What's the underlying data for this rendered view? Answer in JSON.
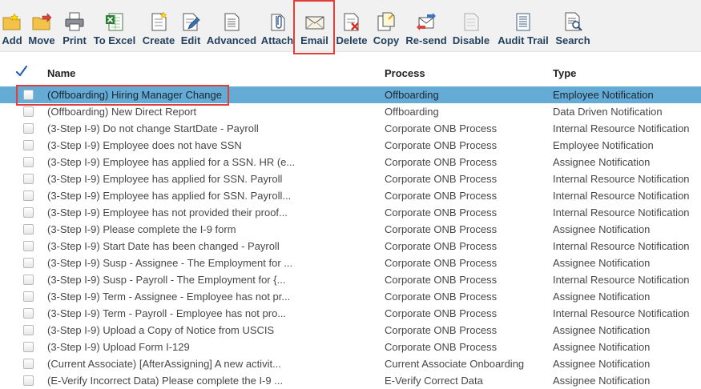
{
  "toolbar": {
    "buttons": [
      {
        "label": "Add",
        "icon": "folder-add-icon"
      },
      {
        "label": "Move",
        "icon": "folder-move-icon"
      },
      {
        "label": "Print",
        "icon": "printer-icon"
      },
      {
        "label": "To Excel",
        "icon": "excel-icon"
      },
      {
        "label": "Create",
        "icon": "create-icon"
      },
      {
        "label": "Edit",
        "icon": "edit-icon"
      },
      {
        "label": "Advanced",
        "icon": "advanced-icon"
      },
      {
        "label": "Attach",
        "icon": "paperclip-icon"
      },
      {
        "label": "Email",
        "icon": "envelope-icon"
      },
      {
        "label": "Delete",
        "icon": "delete-icon"
      },
      {
        "label": "Copy",
        "icon": "copy-icon"
      },
      {
        "label": "Re-send",
        "icon": "resend-icon"
      },
      {
        "label": "Disable",
        "icon": "disable-icon"
      },
      {
        "label": "Audit Trail",
        "icon": "audit-trail-icon"
      },
      {
        "label": "Search",
        "icon": "search-icon"
      }
    ]
  },
  "table": {
    "columns": {
      "name": "Name",
      "process": "Process",
      "type": "Type"
    },
    "rows": [
      {
        "name": "(Offboarding) Hiring Manager Change",
        "process": "Offboarding",
        "type": "Employee Notification",
        "selected": true
      },
      {
        "name": "(Offboarding) New Direct Report",
        "process": "Offboarding",
        "type": "Data Driven Notification"
      },
      {
        "name": "(3-Step I-9) Do not change StartDate - Payroll",
        "process": "Corporate ONB Process",
        "type": "Internal Resource Notification"
      },
      {
        "name": "(3-Step I-9) Employee does not have SSN",
        "process": "Corporate ONB Process",
        "type": "Employee Notification"
      },
      {
        "name": "(3-Step I-9) Employee has applied for a SSN. HR (e...",
        "process": "Corporate ONB Process",
        "type": "Assignee Notification"
      },
      {
        "name": "(3-Step I-9) Employee has applied for SSN. Payroll",
        "process": "Corporate ONB Process",
        "type": "Internal Resource Notification"
      },
      {
        "name": "(3-Step I-9) Employee has applied for SSN. Payroll...",
        "process": "Corporate ONB Process",
        "type": "Internal Resource Notification"
      },
      {
        "name": "(3-Step I-9) Employee has not provided their proof...",
        "process": "Corporate ONB Process",
        "type": "Internal Resource Notification"
      },
      {
        "name": "(3-Step I-9) Please complete the I-9 form",
        "process": "Corporate ONB Process",
        "type": "Assignee Notification"
      },
      {
        "name": "(3-Step I-9) Start Date has been changed - Payroll",
        "process": "Corporate ONB Process",
        "type": "Internal Resource Notification"
      },
      {
        "name": "(3-Step I-9) Susp - Assignee - The Employment for ...",
        "process": "Corporate ONB Process",
        "type": "Assignee Notification"
      },
      {
        "name": "(3-Step I-9) Susp - Payroll - The Employment for {...",
        "process": "Corporate ONB Process",
        "type": "Internal Resource Notification"
      },
      {
        "name": "(3-Step I-9) Term - Assignee - Employee has not pr...",
        "process": "Corporate ONB Process",
        "type": "Assignee Notification"
      },
      {
        "name": "(3-Step I-9) Term - Payroll - Employee has not pro...",
        "process": "Corporate ONB Process",
        "type": "Internal Resource Notification"
      },
      {
        "name": "(3-Step I-9) Upload a Copy of Notice from USCIS",
        "process": "Corporate ONB Process",
        "type": "Assignee Notification"
      },
      {
        "name": "(3-Step I-9) Upload Form I-129",
        "process": "Corporate ONB Process",
        "type": "Assignee Notification"
      },
      {
        "name": "(Current Associate) [AfterAssigning] A new activit...",
        "process": "Current Associate Onboarding",
        "type": "Assignee Notification"
      },
      {
        "name": "(E-Verify Incorrect Data) Please complete the I-9 ...",
        "process": "E-Verify Correct Data",
        "type": "Assignee Notification"
      }
    ]
  },
  "colors": {
    "selected_row": "#64acd5",
    "annotation_box": "#e0403c",
    "toolbar_label": "#23415f"
  }
}
